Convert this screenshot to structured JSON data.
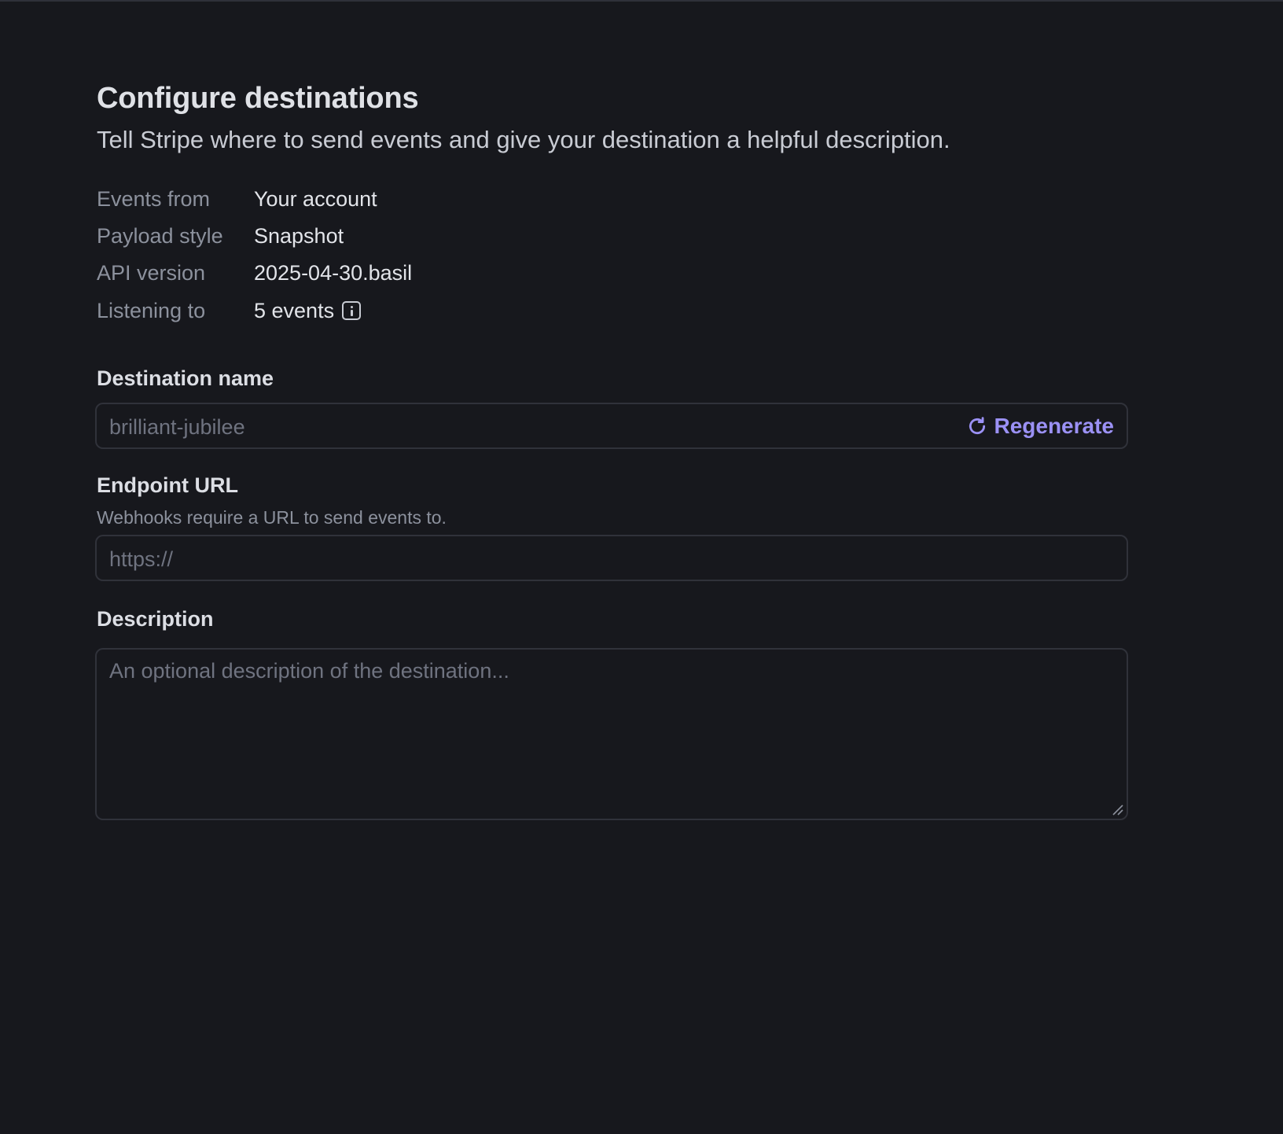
{
  "header": {
    "title": "Configure destinations",
    "subtitle": "Tell Stripe where to send events and give your destination a helpful description."
  },
  "summary": [
    {
      "label": "Events from",
      "value": "Your account"
    },
    {
      "label": "Payload style",
      "value": "Snapshot"
    },
    {
      "label": "API version",
      "value": "2025-04-30.basil"
    },
    {
      "label": "Listening to",
      "value": "5 events",
      "icon": "info-icon"
    }
  ],
  "destination_name": {
    "label": "Destination name",
    "placeholder": "brilliant-jubilee",
    "regenerate_label": "Regenerate",
    "regenerate_icon": "refresh-icon"
  },
  "endpoint_url": {
    "label": "Endpoint URL",
    "help": "Webhooks require a URL to send events to.",
    "placeholder": "https://"
  },
  "description": {
    "label": "Description",
    "placeholder": "An optional description of the destination..."
  },
  "colors": {
    "background": "#17181d",
    "accent": "#9b91f5",
    "border": "#30323a",
    "muted_text": "#8c919d",
    "placeholder_text": "#6f7380"
  }
}
